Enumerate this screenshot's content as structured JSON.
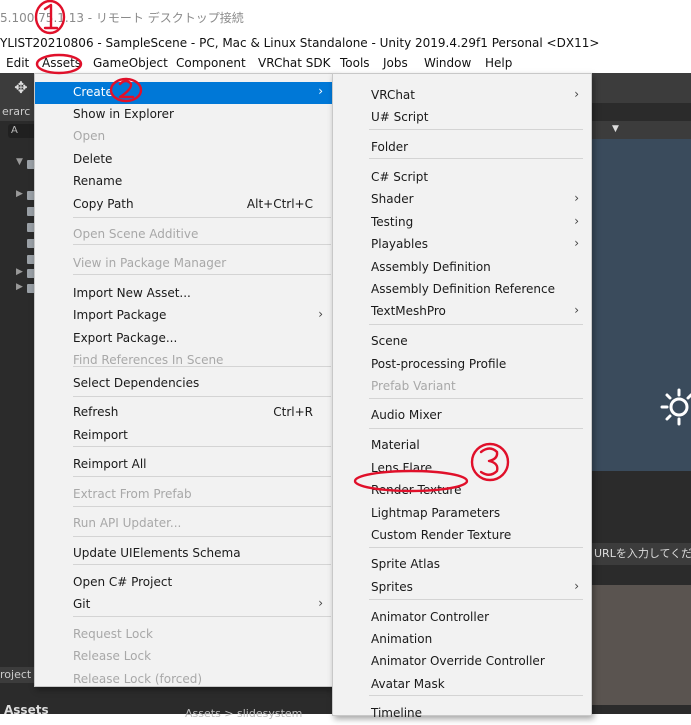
{
  "rdp": {
    "title": "5.100.75.1.13 - リモート デスクトップ接続"
  },
  "unity": {
    "title": "YLIST20210806 - SampleScene - PC, Mac & Linux Standalone - Unity 2019.4.29f1 Personal <DX11>"
  },
  "menubar": [
    {
      "label": "Edit"
    },
    {
      "label": "Assets"
    },
    {
      "label": "GameObject"
    },
    {
      "label": "Component"
    },
    {
      "label": "VRChat SDK"
    },
    {
      "label": "Tools"
    },
    {
      "label": "Jobs"
    },
    {
      "label": "Window"
    },
    {
      "label": "Help"
    }
  ],
  "editor": {
    "hierarchy_tab": "erarc",
    "search_text": "A",
    "project_tab": "roject",
    "assets_label": "Assets",
    "breadcrumb": "Assets > slidesystem",
    "url_placeholder": "URLを入力してくださ"
  },
  "assets_menu": {
    "items": [
      {
        "label": "Create",
        "arrow": "›"
      },
      {
        "label": "Show in Explorer"
      },
      {
        "label": "Open"
      },
      {
        "label": "Delete"
      },
      {
        "label": "Rename"
      },
      {
        "label": "Copy Path",
        "shortcut": "Alt+Ctrl+C"
      },
      {
        "label": "Open Scene Additive"
      },
      {
        "label": "View in Package Manager"
      },
      {
        "label": "Import New Asset..."
      },
      {
        "label": "Import Package",
        "arrow": "›"
      },
      {
        "label": "Export Package..."
      },
      {
        "label": "Find References In Scene"
      },
      {
        "label": "Select Dependencies"
      },
      {
        "label": "Refresh",
        "shortcut": "Ctrl+R"
      },
      {
        "label": "Reimport"
      },
      {
        "label": "Reimport All"
      },
      {
        "label": "Extract From Prefab"
      },
      {
        "label": "Run API Updater..."
      },
      {
        "label": "Update UIElements Schema"
      },
      {
        "label": "Open C# Project"
      },
      {
        "label": "Git",
        "arrow": "›"
      },
      {
        "label": "Request Lock"
      },
      {
        "label": "Release Lock"
      },
      {
        "label": "Release Lock (forced)"
      }
    ]
  },
  "create_menu": {
    "items": [
      {
        "label": "VRChat",
        "arrow": "›"
      },
      {
        "label": "U# Script"
      },
      {
        "label": "Folder"
      },
      {
        "label": "C# Script"
      },
      {
        "label": "Shader",
        "arrow": "›"
      },
      {
        "label": "Testing",
        "arrow": "›"
      },
      {
        "label": "Playables",
        "arrow": "›"
      },
      {
        "label": "Assembly Definition"
      },
      {
        "label": "Assembly Definition Reference"
      },
      {
        "label": "TextMeshPro",
        "arrow": "›"
      },
      {
        "label": "Scene"
      },
      {
        "label": "Post-processing Profile"
      },
      {
        "label": "Prefab Variant"
      },
      {
        "label": "Audio Mixer"
      },
      {
        "label": "Material"
      },
      {
        "label": "Lens Flare"
      },
      {
        "label": "Render Texture"
      },
      {
        "label": "Lightmap Parameters"
      },
      {
        "label": "Custom Render Texture"
      },
      {
        "label": "Sprite Atlas"
      },
      {
        "label": "Sprites",
        "arrow": "›"
      },
      {
        "label": "Animator Controller"
      },
      {
        "label": "Animation"
      },
      {
        "label": "Animator Override Controller"
      },
      {
        "label": "Avatar Mask"
      },
      {
        "label": "Timeline"
      }
    ]
  },
  "colors": {
    "highlight": "#0078d7",
    "annotation": "#e0102a",
    "editor_bg": "#2b2b2b"
  }
}
